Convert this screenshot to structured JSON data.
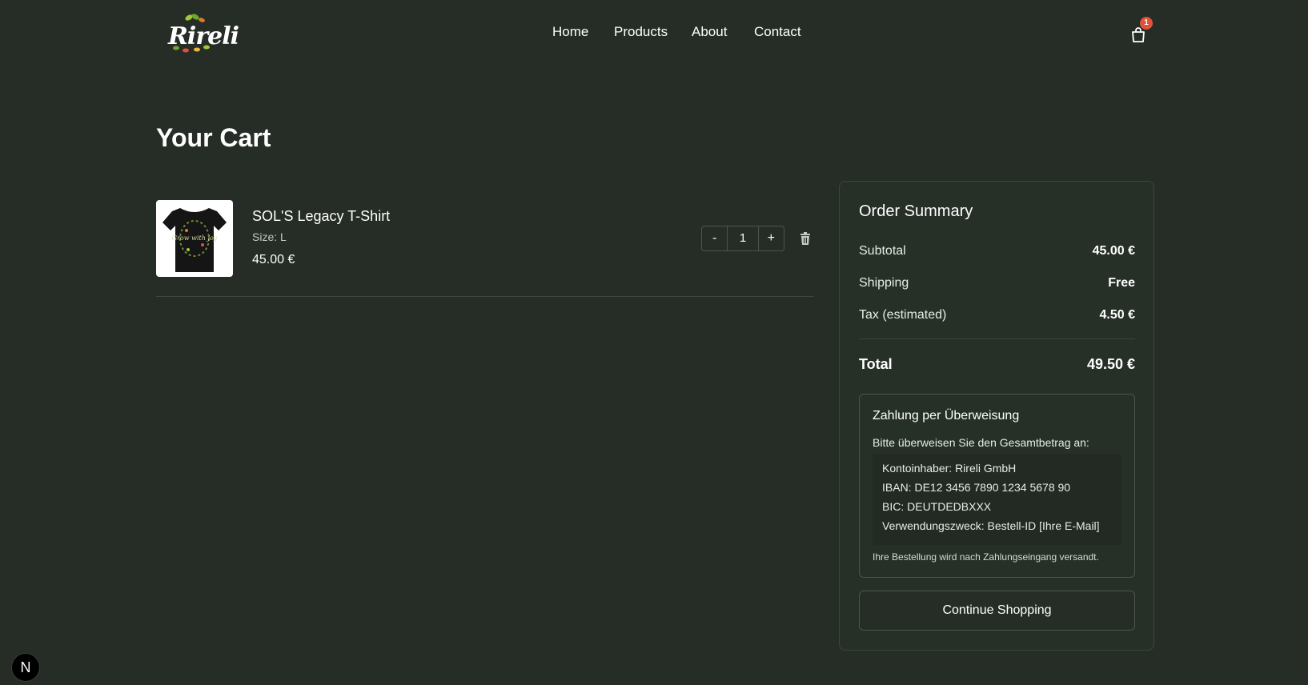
{
  "header": {
    "logo_text": "Rireli",
    "nav": [
      {
        "label": "Home"
      },
      {
        "label": "Products"
      },
      {
        "label": "About"
      },
      {
        "label": "Contact"
      }
    ],
    "cart_count": "1"
  },
  "page_title": "Your Cart",
  "cart_items": [
    {
      "name": "SOL'S Legacy T-Shirt",
      "size": "Size: L",
      "price": "45.00 €",
      "quantity": "1",
      "decrement_label": "-",
      "increment_label": "+",
      "image_text": "Grow with joy"
    }
  ],
  "summary": {
    "title": "Order Summary",
    "rows": [
      {
        "label": "Subtotal",
        "value": "45.00 €"
      },
      {
        "label": "Shipping",
        "value": "Free"
      },
      {
        "label": "Tax (estimated)",
        "value": "4.50 €"
      }
    ],
    "total_label": "Total",
    "total_value": "49.50 €",
    "bank": {
      "title": "Zahlung per Überweisung",
      "intro": "Bitte überweisen Sie den Gesamtbetrag an:",
      "lines": [
        "Kontoinhaber: Rireli GmbH",
        "IBAN: DE12 3456 7890 1234 5678 90",
        "BIC: DEUTDEDBXXX",
        "Verwendungszweck: Bestell-ID [Ihre E-Mail]"
      ],
      "note": "Ihre Bestellung wird nach Zahlungseingang versandt."
    },
    "continue_label": "Continue Shopping"
  },
  "dev_badge": "N",
  "colors": {
    "background": "#252d26",
    "badge": "#e0523a",
    "border": "#4a564c"
  },
  "icons": [
    "cart-icon",
    "trash-icon",
    "leaf-icon"
  ]
}
